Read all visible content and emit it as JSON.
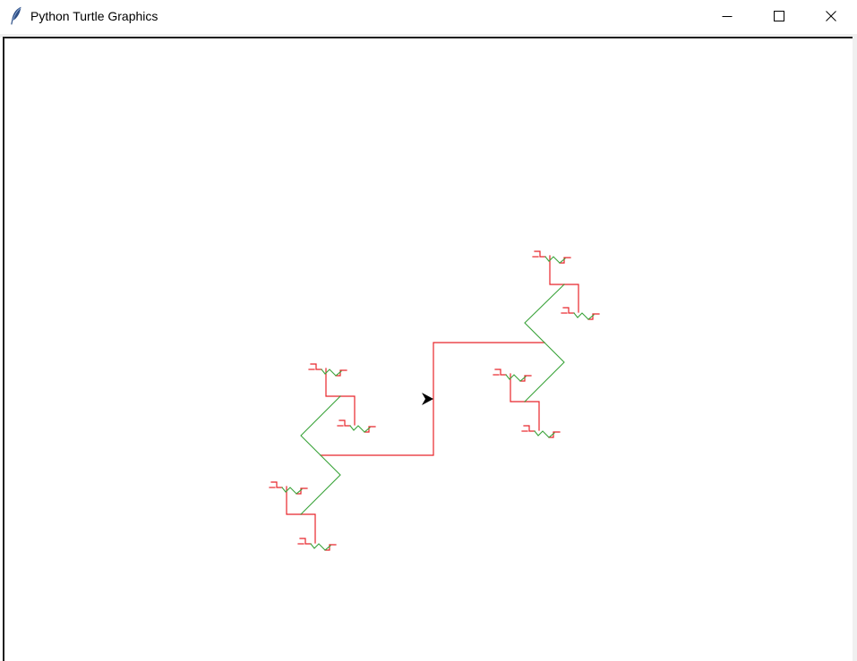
{
  "window": {
    "title": "Python Turtle Graphics",
    "icon": "feather-icon",
    "controls": [
      "minimize-icon",
      "maximize-icon",
      "close-icon"
    ]
  },
  "canvas": {
    "background": "#ffffff",
    "colors": {
      "red": "#e8242a",
      "green": "#3aa33a",
      "turtle": "#000000"
    },
    "turtle_cursor": "arrow-icon"
  }
}
